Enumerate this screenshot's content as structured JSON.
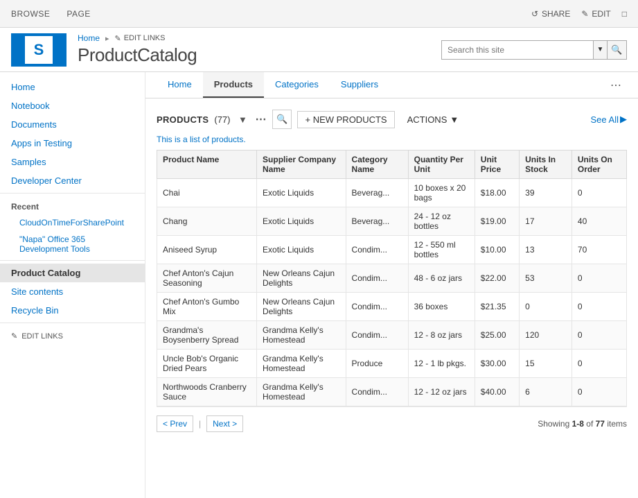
{
  "topbar": {
    "browse": "BROWSE",
    "page": "PAGE",
    "share": "SHARE",
    "edit": "EDIT"
  },
  "header": {
    "breadcrumb_home": "Home",
    "edit_links": "EDIT LINKS",
    "site_title": "ProductCatalog",
    "search_placeholder": "Search this site"
  },
  "sidebar": {
    "items": [
      {
        "label": "Home",
        "active": false,
        "sub": false
      },
      {
        "label": "Notebook",
        "active": false,
        "sub": false
      },
      {
        "label": "Documents",
        "active": false,
        "sub": false
      },
      {
        "label": "Apps in Testing",
        "active": false,
        "sub": false
      },
      {
        "label": "Samples",
        "active": false,
        "sub": false
      },
      {
        "label": "Developer Center",
        "active": false,
        "sub": false
      }
    ],
    "recent_label": "Recent",
    "recent_items": [
      {
        "label": "CloudOnTimeForSharePoint"
      },
      {
        "label": "\"Napa\" Office 365 Development Tools"
      }
    ],
    "current_item": "Product Catalog",
    "bottom_items": [
      {
        "label": "Site contents"
      },
      {
        "label": "Recycle Bin"
      }
    ],
    "edit_links": "EDIT LINKS"
  },
  "tabs": {
    "items": [
      {
        "label": "Home",
        "active": false
      },
      {
        "label": "Products",
        "active": true
      },
      {
        "label": "Categories",
        "active": false
      },
      {
        "label": "Suppliers",
        "active": false
      }
    ]
  },
  "list": {
    "title": "PRODUCTS",
    "count": "(77)",
    "description": "This is a list of products.",
    "new_button": "+ NEW PRODUCTS",
    "actions_button": "ACTIONS",
    "see_all": "See All",
    "columns": [
      "Product Name",
      "Supplier Company Name",
      "Category Name",
      "Quantity Per Unit",
      "Unit Price",
      "Units In Stock",
      "Units On Order"
    ],
    "rows": [
      {
        "product_name": "Chai",
        "supplier": "Exotic Liquids",
        "category": "Beverag...",
        "qty_per_unit": "10 boxes x 20 bags",
        "unit_price": "$18.00",
        "units_in_stock": "39",
        "units_on_order": "0"
      },
      {
        "product_name": "Chang",
        "supplier": "Exotic Liquids",
        "category": "Beverag...",
        "qty_per_unit": "24 - 12 oz bottles",
        "unit_price": "$19.00",
        "units_in_stock": "17",
        "units_on_order": "40"
      },
      {
        "product_name": "Aniseed Syrup",
        "supplier": "Exotic Liquids",
        "category": "Condim...",
        "qty_per_unit": "12 - 550 ml bottles",
        "unit_price": "$10.00",
        "units_in_stock": "13",
        "units_on_order": "70"
      },
      {
        "product_name": "Chef Anton's Cajun Seasoning",
        "supplier": "New Orleans Cajun Delights",
        "category": "Condim...",
        "qty_per_unit": "48 - 6 oz jars",
        "unit_price": "$22.00",
        "units_in_stock": "53",
        "units_on_order": "0"
      },
      {
        "product_name": "Chef Anton's Gumbo Mix",
        "supplier": "New Orleans Cajun Delights",
        "category": "Condim...",
        "qty_per_unit": "36 boxes",
        "unit_price": "$21.35",
        "units_in_stock": "0",
        "units_on_order": "0"
      },
      {
        "product_name": "Grandma's Boysenberry Spread",
        "supplier": "Grandma Kelly's Homestead",
        "category": "Condim...",
        "qty_per_unit": "12 - 8 oz jars",
        "unit_price": "$25.00",
        "units_in_stock": "120",
        "units_on_order": "0"
      },
      {
        "product_name": "Uncle Bob's Organic Dried Pears",
        "supplier": "Grandma Kelly's Homestead",
        "category": "Produce",
        "qty_per_unit": "12 - 1 lb pkgs.",
        "unit_price": "$30.00",
        "units_in_stock": "15",
        "units_on_order": "0"
      },
      {
        "product_name": "Northwoods Cranberry Sauce",
        "supplier": "Grandma Kelly's Homestead",
        "category": "Condim...",
        "qty_per_unit": "12 - 12 oz jars",
        "unit_price": "$40.00",
        "units_in_stock": "6",
        "units_on_order": "0"
      }
    ],
    "pagination": {
      "prev": "< Prev",
      "next": "Next >",
      "showing_prefix": "Showing ",
      "showing_range": "1-8",
      "showing_middle": " of ",
      "showing_total": "77",
      "showing_suffix": " items"
    }
  }
}
